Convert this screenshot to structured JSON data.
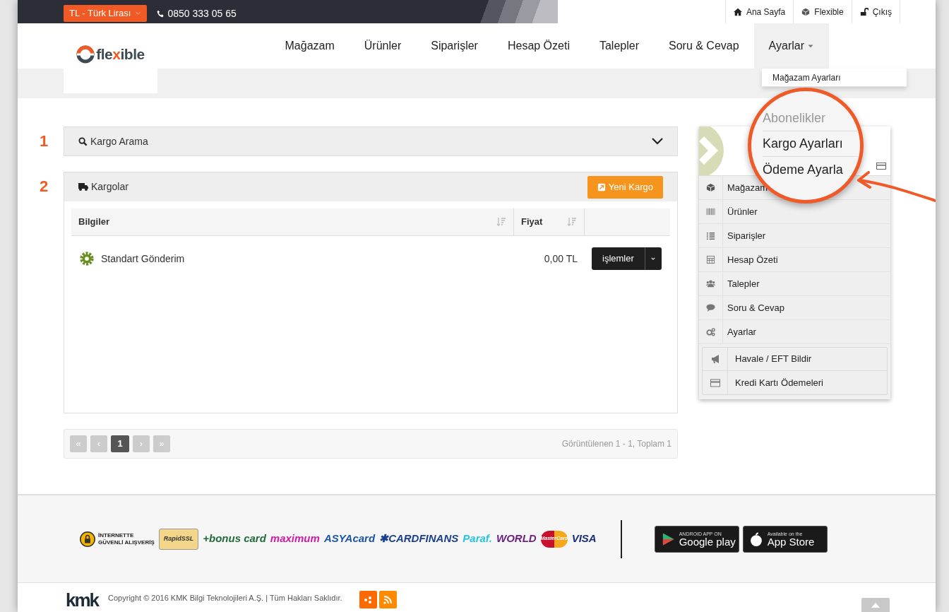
{
  "top_bar": {
    "currency": "TL - Türk Lirası",
    "phone": "0850 333 05 65",
    "links": [
      "Ana Sayfa",
      "Flexible",
      "Çıkış"
    ]
  },
  "logo": {
    "text_a": "fle",
    "text_x": "x",
    "text_b": "ible"
  },
  "nav": [
    {
      "label": "Mağazam",
      "selected": false
    },
    {
      "label": "Ürünler",
      "selected": false
    },
    {
      "label": "Siparişler",
      "selected": false
    },
    {
      "label": "Hesap Özeti",
      "selected": false
    },
    {
      "label": "Talepler",
      "selected": false
    },
    {
      "label": "Soru & Cevap",
      "selected": false
    },
    {
      "label": "Ayarlar",
      "selected": true
    }
  ],
  "dropdown_menu": [
    "Mağazam Ayarları"
  ],
  "magnifier": [
    {
      "label": "Abonelikler",
      "disabled": true
    },
    {
      "label": "Kargo Ayarları",
      "disabled": false
    },
    {
      "label": "Ödeme Ayarla",
      "disabled": false
    }
  ],
  "steps": [
    "1",
    "2"
  ],
  "search_panel": {
    "title": "Kargo Arama",
    "expanded": false
  },
  "cargo_panel": {
    "title": "Kargolar",
    "new_button": "Yeni Kargo",
    "columns": [
      "Bilgiler",
      "Fiyat"
    ],
    "rows": [
      {
        "name": "Standart Gönderim",
        "price": "0,00 TL",
        "action": "işlemler"
      }
    ]
  },
  "pagination": {
    "pages": [
      {
        "label": "«",
        "kind": "nav"
      },
      {
        "label": "‹",
        "kind": "nav"
      },
      {
        "label": "1",
        "kind": "page",
        "selected": true
      },
      {
        "label": "›",
        "kind": "nav"
      },
      {
        "label": "»",
        "kind": "nav"
      }
    ],
    "summary": "Görüntülenen 1 - 1, Toplam 1"
  },
  "side_menu": [
    "Mağazam",
    "Ürünler",
    "Siparişler",
    "Hesap Özeti",
    "Talepler",
    "Soru & Cevap",
    "Ayarlar"
  ],
  "side_sub_menu": [
    "Havale / EFT Bildir",
    "Kredi Kartı Ödemeleri"
  ],
  "payment_logos": [
    {
      "text": "İNTERNETTE\nGÜVENLİ ALIŞVERİŞ",
      "kind": "secure"
    },
    {
      "text": "RapidSSL",
      "kind": "ssl"
    },
    {
      "text": "+bonus card",
      "color": "#1f6b3a",
      "kind": "word"
    },
    {
      "text": "maximum",
      "color": "#d21aa8",
      "kind": "word"
    },
    {
      "text": "ASYAcard",
      "color": "#1a56a6",
      "kind": "word"
    },
    {
      "text": "✱CARDFINANS",
      "color": "#1a3f8f",
      "kind": "word"
    },
    {
      "text": "Paraf.",
      "color": "#29c3e8",
      "kind": "word"
    },
    {
      "text": "WORLD",
      "color": "#6b1f7f",
      "kind": "word"
    },
    {
      "text": "MasterCard",
      "kind": "mastercard"
    },
    {
      "text": "VISA",
      "color": "#1a2a7a",
      "kind": "word"
    }
  ],
  "app_badges": [
    {
      "small": "ANDROID APP ON",
      "big": "Google play",
      "kind": "google"
    },
    {
      "small": "Available on the",
      "big": "App Store",
      "kind": "apple"
    }
  ],
  "footer": {
    "brand": "kmk",
    "copyright": "Copyright © 2016 KMK Bilgi Teknolojileri A.Ş. | Tüm Hakları Saklıdır."
  }
}
